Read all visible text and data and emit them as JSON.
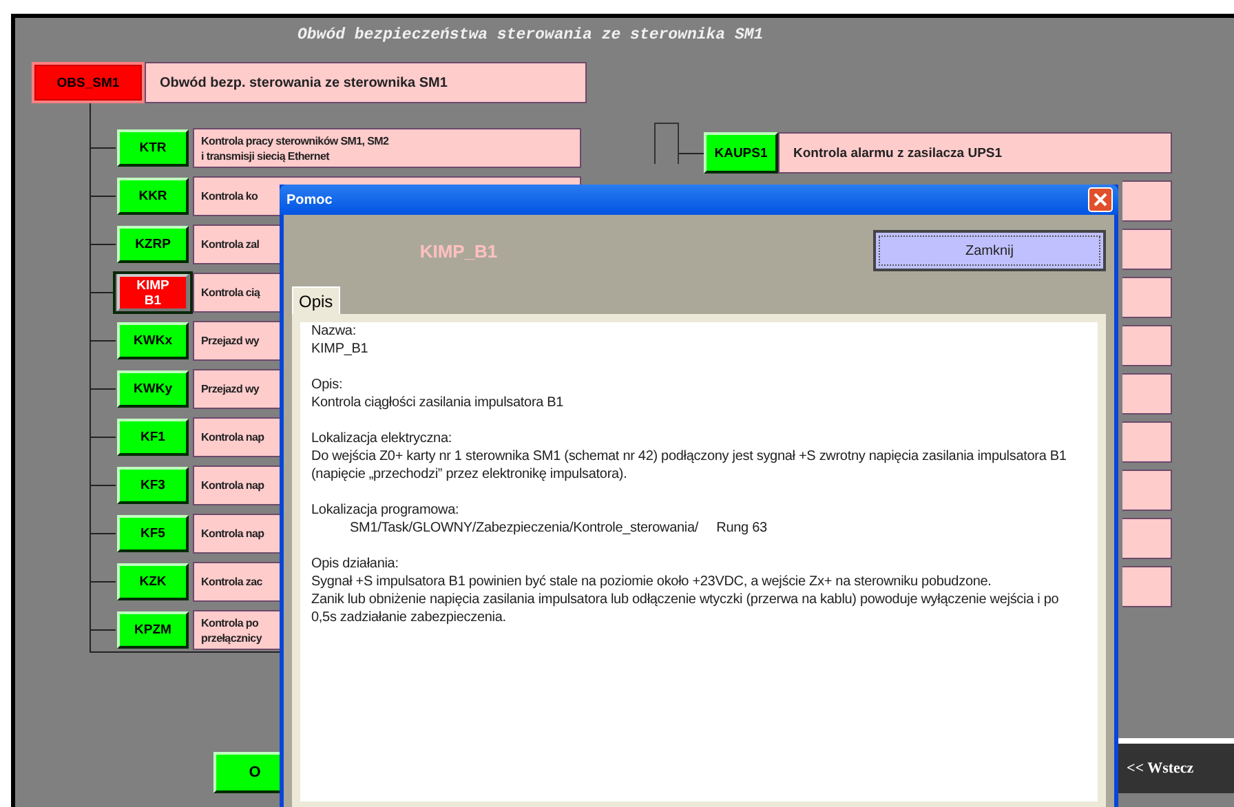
{
  "title": "Obwód bezpieczeństwa sterowania ze sterownika SM1",
  "root": {
    "code": "OBS_SM1",
    "description": "Obwód bezp. sterowania ze sterownika SM1",
    "alarm": true
  },
  "left_rows": [
    {
      "code": "KTR",
      "description": "Kontrola pracy sterowników SM1, SM2\ni transmisji siecią Ethernet",
      "alarm": false,
      "selected": false
    },
    {
      "code": "KKR",
      "description": "Kontrola ko",
      "alarm": false,
      "selected": false
    },
    {
      "code": "KZRP",
      "description": "Kontrola zal",
      "alarm": false,
      "selected": false
    },
    {
      "code": "KIMP\nB1",
      "description": "Kontrola cią",
      "alarm": true,
      "selected": true
    },
    {
      "code": "KWKx",
      "description": "Przejazd wy",
      "alarm": false,
      "selected": false
    },
    {
      "code": "KWKy",
      "description": "Przejazd wy",
      "alarm": false,
      "selected": false
    },
    {
      "code": "KF1",
      "description": "Kontrola nap",
      "alarm": false,
      "selected": false
    },
    {
      "code": "KF3",
      "description": "Kontrola nap",
      "alarm": false,
      "selected": false
    },
    {
      "code": "KF5",
      "description": "Kontrola nap",
      "alarm": false,
      "selected": false
    },
    {
      "code": "KZK",
      "description": "Kontrola zac",
      "alarm": false,
      "selected": false
    },
    {
      "code": "KPZM",
      "description": "Kontrola po\nprzełącznicy",
      "alarm": false,
      "selected": false
    }
  ],
  "right_rows": [
    {
      "kind": "full",
      "code": "KAUPS1",
      "description": "Kontrola alarmu z zasilacza UPS1",
      "alarm": false
    },
    {
      "kind": "covered"
    },
    {
      "kind": "covered"
    },
    {
      "kind": "covered"
    },
    {
      "kind": "covered"
    },
    {
      "kind": "covered"
    },
    {
      "kind": "covered"
    },
    {
      "kind": "covered"
    },
    {
      "kind": "covered"
    },
    {
      "kind": "covered"
    }
  ],
  "bottom_button": {
    "label": "O",
    "alarm": false
  },
  "back_button": {
    "label": "<< Wstecz"
  },
  "dialog": {
    "title": "Pomoc",
    "heading": "KIMP_B1",
    "close_button": "Zamknij",
    "tabs": [
      {
        "label": "Opis",
        "selected": true
      }
    ],
    "sections": [
      {
        "label": "Nazwa:",
        "lines": [
          "KIMP_B1"
        ],
        "indent": false
      },
      {
        "label": "Opis:",
        "lines": [
          "Kontrola ciągłości zasilania impulsatora B1"
        ],
        "indent": false
      },
      {
        "label": "Lokalizacja elektryczna:",
        "lines": [
          "Do wejścia Z0+ karty nr 1 sterownika SM1 (schemat nr 42) podłączony jest sygnał +S zwrotny napięcia zasilania impulsatora B1 (napięcie „przechodzi” przez elektronikę impulsatora)."
        ],
        "indent": false
      },
      {
        "label": "Lokalizacja programowa:",
        "lines": [
          "SM1/Task/GLOWNY/Zabezpieczenia/Kontrole_sterowania/     Rung 63"
        ],
        "indent": true
      },
      {
        "label": "Opis działania:",
        "lines": [
          "Sygnał +S impulsatora B1 powinien być stale na poziomie około +23VDC, a wejście Zx+ na sterowniku pobudzone.",
          "Zanik lub obniżenie napięcia zasilania impulsatora lub odłączenie wtyczki (przerwa na kablu) powoduje wyłączenie wejścia i po 0,5s zadziałanie zabezpieczenia."
        ],
        "indent": false
      }
    ]
  }
}
